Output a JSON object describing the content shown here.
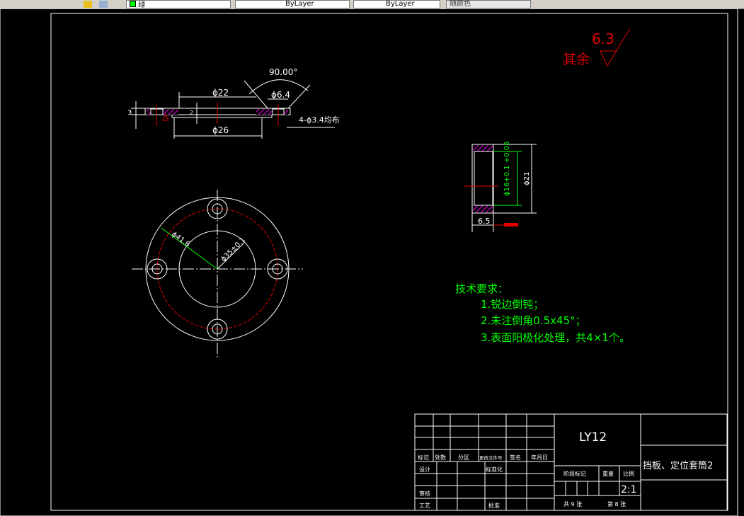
{
  "toolbar": {
    "color_select": "绿",
    "linetype_select": "ByLayer",
    "lineweight_select": "ByLayer",
    "plotstyle_select": "随颜色"
  },
  "drawing": {
    "roughness_other": "其余",
    "roughness_value": "6.3",
    "top_view": {
      "angle": "90.00°",
      "dia_22": "ϕ22",
      "dia_6_4": "ϕ6.4",
      "dia_26": "ϕ26",
      "thickness_3": "3",
      "depth_2": "2",
      "holes_note": "4-ϕ3.4均布"
    },
    "flange": {
      "dia_41_6": "ϕ41.6",
      "dia_35": "ϕ35±0.1"
    },
    "sleeve": {
      "dia_16": "ϕ16+0.1 +0.05",
      "dia_21": "ϕ21",
      "length": "6.5"
    },
    "tech_req": {
      "title": "技术要求：",
      "items": [
        "1.锐边倒钝；",
        "2.未注倒角0.5x45°；",
        "3.表面阳极化处理，共4×1个。"
      ]
    }
  },
  "title_block": {
    "material": "LY12",
    "part_name": "挡板、定位套筒2",
    "headers": [
      "标记",
      "处数",
      "分区",
      "更改文件号",
      "签名",
      "年月日"
    ],
    "design": "设计",
    "standardization": "标准化",
    "review": "审核",
    "process": "工艺",
    "approve": "批准",
    "stage_mark": "阶段标记",
    "weight": "重量",
    "scale_label": "比例",
    "scale": "2:1",
    "sheets_total": "共 9 张",
    "sheet_no": "第 8 张"
  }
}
